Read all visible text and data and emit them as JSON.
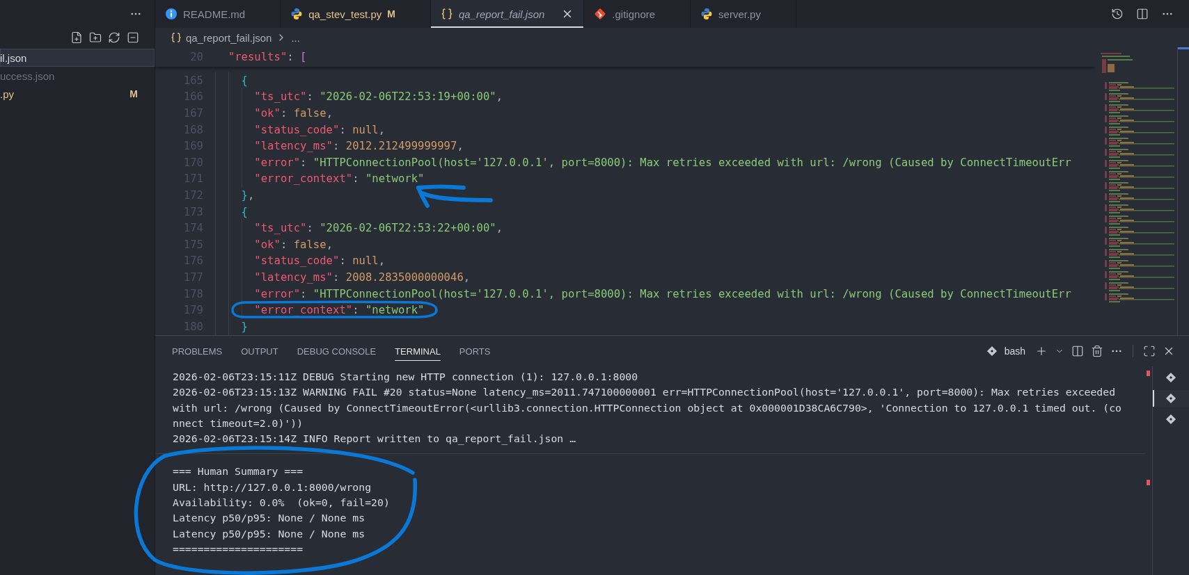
{
  "explorer": {
    "files": [
      {
        "label": "il.json",
        "selected": true,
        "dimmed": false,
        "modified": false
      },
      {
        "label": "uccess.json",
        "selected": false,
        "dimmed": true,
        "modified": false
      },
      {
        "label": ".py",
        "selected": false,
        "dimmed": false,
        "modified": true,
        "badge": "M"
      }
    ]
  },
  "tabs": [
    {
      "label": "README.md",
      "kind": "info",
      "selected": false,
      "preview": false,
      "modified": false
    },
    {
      "label": "qa_stev_test.py",
      "kind": "python",
      "selected": false,
      "preview": false,
      "modified": true,
      "badge": "M"
    },
    {
      "label": "qa_report_fail.json",
      "kind": "json",
      "selected": true,
      "preview": true,
      "modified": false
    },
    {
      "label": ".gitignore",
      "kind": "git",
      "selected": false,
      "preview": false,
      "modified": false
    },
    {
      "label": "server.py",
      "kind": "python",
      "selected": false,
      "preview": false,
      "modified": false
    }
  ],
  "breadcrumb": {
    "file": "qa_report_fail.json",
    "more": "..."
  },
  "editor": {
    "sticky": {
      "number": "20",
      "tokens": [
        {
          "kind": "key",
          "text": "  \"results\""
        },
        {
          "kind": "punct",
          "text": ": "
        },
        {
          "kind": "square",
          "text": "["
        }
      ]
    },
    "lines": [
      {
        "number": "165",
        "tokens": [
          {
            "kind": "brace",
            "text": "    {"
          }
        ]
      },
      {
        "number": "166",
        "tokens": [
          {
            "kind": "key",
            "text": "      \"ts_utc\""
          },
          {
            "kind": "punct",
            "text": ": "
          },
          {
            "kind": "string",
            "text": "\"2026-02-06T22:53:19+00:00\""
          },
          {
            "kind": "punct",
            "text": ","
          }
        ]
      },
      {
        "number": "167",
        "tokens": [
          {
            "kind": "key",
            "text": "      \"ok\""
          },
          {
            "kind": "punct",
            "text": ": "
          },
          {
            "kind": "literal",
            "text": "false"
          },
          {
            "kind": "punct",
            "text": ","
          }
        ]
      },
      {
        "number": "168",
        "tokens": [
          {
            "kind": "key",
            "text": "      \"status_code\""
          },
          {
            "kind": "punct",
            "text": ": "
          },
          {
            "kind": "literal",
            "text": "null"
          },
          {
            "kind": "punct",
            "text": ","
          }
        ]
      },
      {
        "number": "169",
        "tokens": [
          {
            "kind": "key",
            "text": "      \"latency_ms\""
          },
          {
            "kind": "punct",
            "text": ": "
          },
          {
            "kind": "literal",
            "text": "2012.212499999997"
          },
          {
            "kind": "punct",
            "text": ","
          }
        ]
      },
      {
        "number": "170",
        "tokens": [
          {
            "kind": "key",
            "text": "      \"error\""
          },
          {
            "kind": "punct",
            "text": ": "
          },
          {
            "kind": "string",
            "text": "\"HTTPConnectionPool(host='127.0.0.1', port=8000): Max retries exceeded with url: /wrong (Caused by ConnectTimeoutErr"
          }
        ]
      },
      {
        "number": "171",
        "tokens": [
          {
            "kind": "key",
            "text": "      \"error_context\""
          },
          {
            "kind": "punct",
            "text": ": "
          },
          {
            "kind": "string",
            "text": "\"network\""
          }
        ]
      },
      {
        "number": "172",
        "tokens": [
          {
            "kind": "brace",
            "text": "    }"
          },
          {
            "kind": "punct",
            "text": ","
          }
        ]
      },
      {
        "number": "173",
        "tokens": [
          {
            "kind": "brace",
            "text": "    {"
          }
        ]
      },
      {
        "number": "174",
        "tokens": [
          {
            "kind": "key",
            "text": "      \"ts_utc\""
          },
          {
            "kind": "punct",
            "text": ": "
          },
          {
            "kind": "string",
            "text": "\"2026-02-06T22:53:22+00:00\""
          },
          {
            "kind": "punct",
            "text": ","
          }
        ]
      },
      {
        "number": "175",
        "tokens": [
          {
            "kind": "key",
            "text": "      \"ok\""
          },
          {
            "kind": "punct",
            "text": ": "
          },
          {
            "kind": "literal",
            "text": "false"
          },
          {
            "kind": "punct",
            "text": ","
          }
        ]
      },
      {
        "number": "176",
        "tokens": [
          {
            "kind": "key",
            "text": "      \"status_code\""
          },
          {
            "kind": "punct",
            "text": ": "
          },
          {
            "kind": "literal",
            "text": "null"
          },
          {
            "kind": "punct",
            "text": ","
          }
        ]
      },
      {
        "number": "177",
        "tokens": [
          {
            "kind": "key",
            "text": "      \"latency_ms\""
          },
          {
            "kind": "punct",
            "text": ": "
          },
          {
            "kind": "literal",
            "text": "2008.2835000000046"
          },
          {
            "kind": "punct",
            "text": ","
          }
        ]
      },
      {
        "number": "178",
        "tokens": [
          {
            "kind": "key",
            "text": "      \"error\""
          },
          {
            "kind": "punct",
            "text": ": "
          },
          {
            "kind": "string",
            "text": "\"HTTPConnectionPool(host='127.0.0.1', port=8000): Max retries exceeded with url: /wrong (Caused by ConnectTimeoutErr"
          }
        ]
      },
      {
        "number": "179",
        "tokens": [
          {
            "kind": "key",
            "text": "      \"error_context\""
          },
          {
            "kind": "punct",
            "text": ": "
          },
          {
            "kind": "string",
            "text": "\"network\""
          }
        ]
      },
      {
        "number": "180",
        "tokens": [
          {
            "kind": "brace",
            "text": "    }"
          }
        ]
      }
    ]
  },
  "panel": {
    "tabs": [
      {
        "label": "PROBLEMS",
        "selected": false
      },
      {
        "label": "OUTPUT",
        "selected": false
      },
      {
        "label": "DEBUG CONSOLE",
        "selected": false
      },
      {
        "label": "TERMINAL",
        "selected": true
      },
      {
        "label": "PORTS",
        "selected": false
      }
    ],
    "shell": "bash",
    "log": [
      "2026-02-06T23:15:11Z DEBUG Starting new HTTP connection (1): 127.0.0.1:8000",
      "2026-02-06T23:15:13Z WARNING FAIL #20 status=None latency_ms=2011.747100000001 err=HTTPConnectionPool(host='127.0.0.1', port=8000): Max retries exceeded",
      "with url: /wrong (Caused by ConnectTimeoutError(<urllib3.connection.HTTPConnection object at 0x000001D38CA6C790>, 'Connection to 127.0.0.1 timed out. (co",
      "nnect timeout=2.0)'))",
      "2026-02-06T23:15:14Z INFO Report written to qa_report_fail.json …"
    ],
    "summary": [
      "=== Human Summary ===",
      "URL: http://127.0.0.1:8000/wrong",
      "Availability: 0.0%  (ok=0, fail=20)",
      "Latency p50/p95: None / None ms",
      "Latency p50/p95: None / None ms",
      "====================="
    ],
    "sessions": [
      {
        "selected": false
      },
      {
        "selected": true
      },
      {
        "selected": false
      }
    ]
  }
}
